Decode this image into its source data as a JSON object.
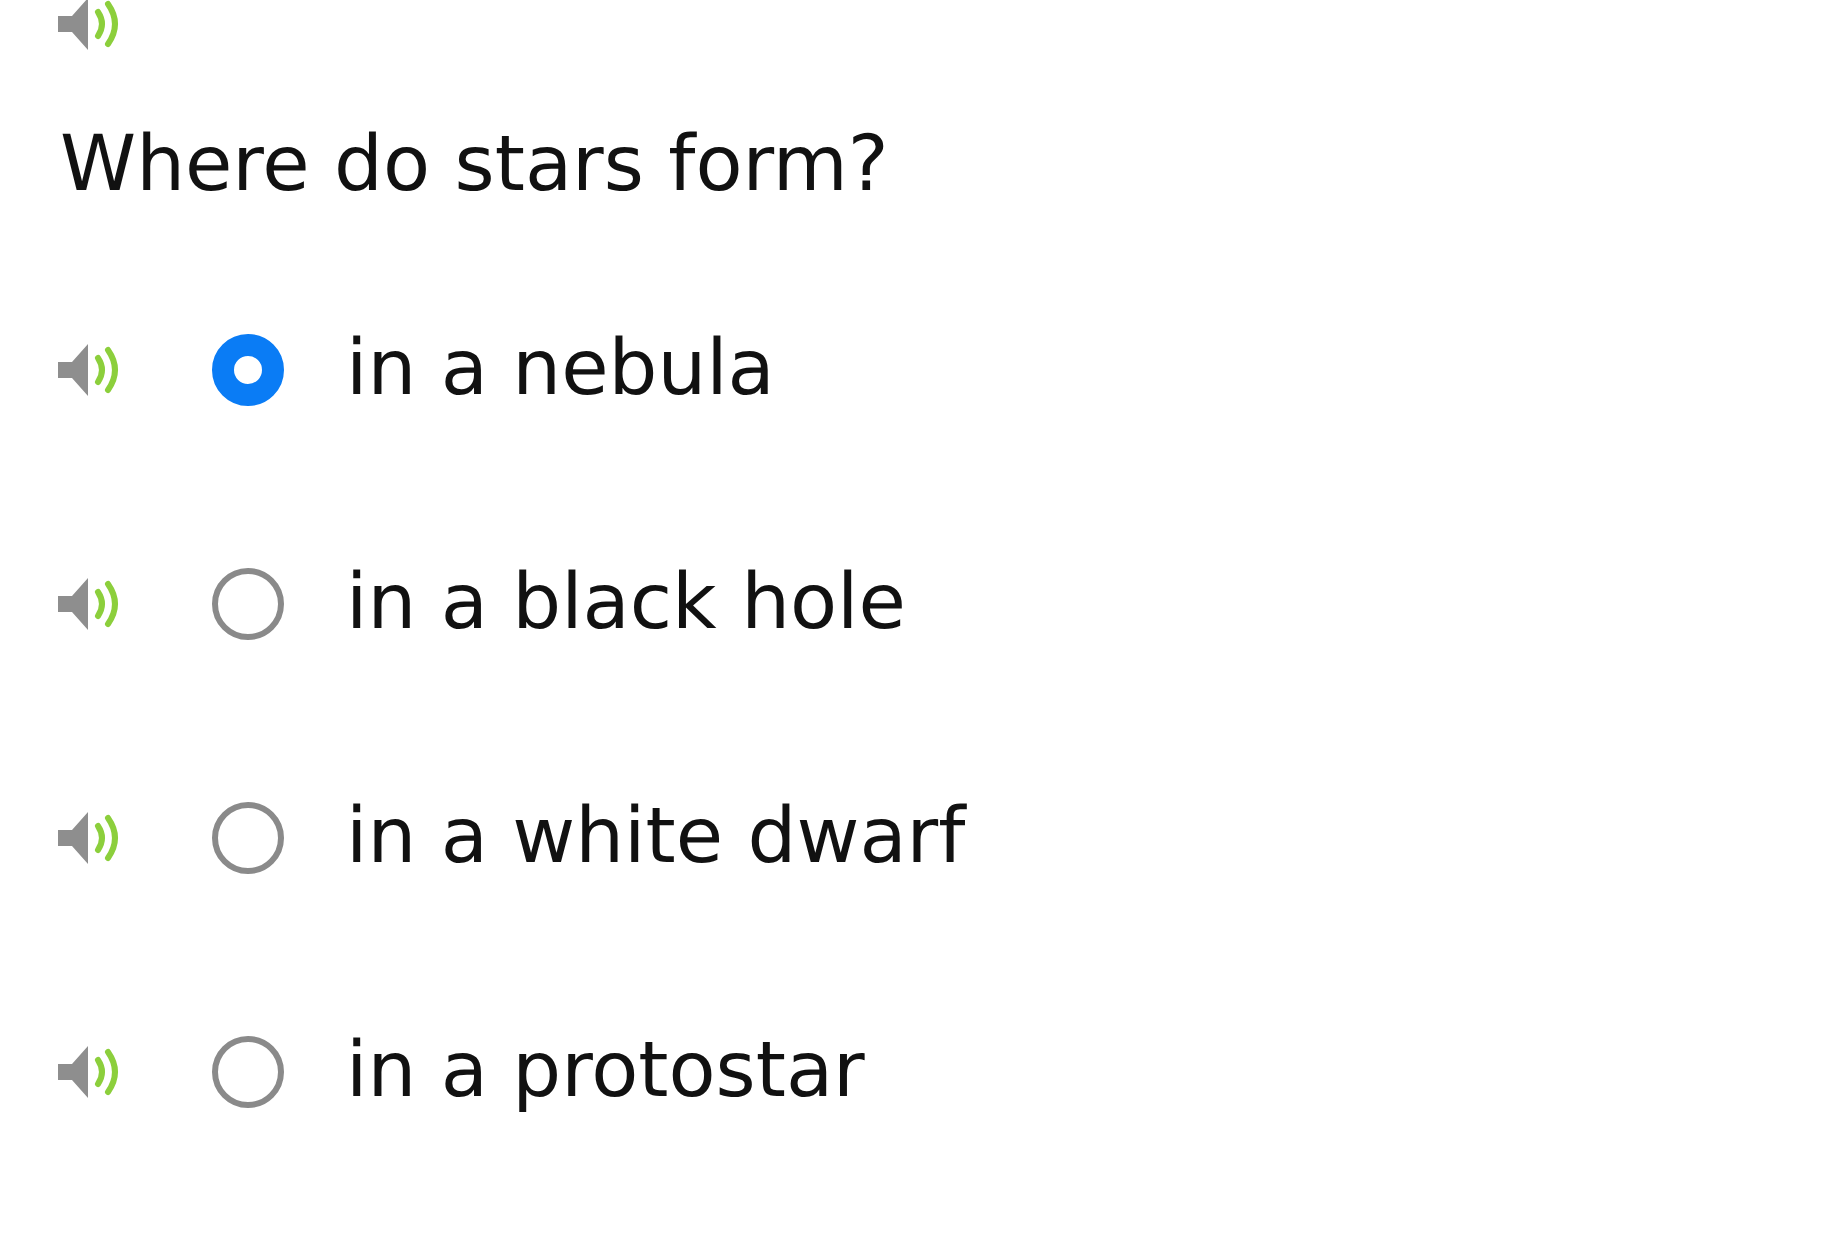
{
  "question": "Where do stars form?",
  "options": [
    {
      "label": "in a nebula",
      "selected": true
    },
    {
      "label": "in a black hole",
      "selected": false
    },
    {
      "label": "in a white dwarf",
      "selected": false
    },
    {
      "label": "in a protostar",
      "selected": false
    }
  ]
}
